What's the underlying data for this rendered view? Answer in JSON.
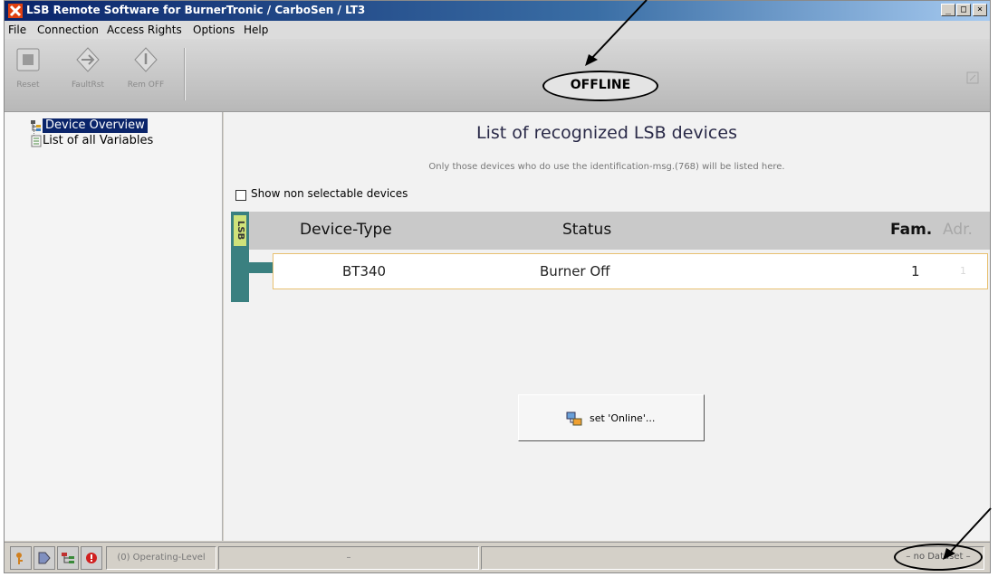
{
  "window": {
    "title": "LSB Remote Software for BurnerTronic / CarboSen / LT3",
    "minimize": "_",
    "maximize": "□",
    "close": "×"
  },
  "menu": [
    "File",
    "Connection",
    "Access Rights",
    "Options",
    "Help"
  ],
  "toolbar": {
    "reset_label": "Reset",
    "faultrst_label": "FaultRst",
    "remoff_label": "Rem OFF",
    "connection_status": "OFFLINE"
  },
  "tree": {
    "items": [
      {
        "label": "Device Overview",
        "selected": true,
        "icon": "device-tree-icon"
      },
      {
        "label": "List of all Variables",
        "selected": false,
        "icon": "variables-list-icon"
      }
    ]
  },
  "main": {
    "title": "List of recognized LSB devices",
    "note": "Only those devices who do use the identification-msg.(768) will be listed here.",
    "show_non_selectable_label": "Show non selectable devices",
    "show_non_selectable_checked": false,
    "bus_label": "LSB",
    "table": {
      "columns": [
        "Device-Type",
        "Status",
        "Fam.",
        "Adr."
      ],
      "rows": [
        {
          "device_type": "BT340",
          "status": "Burner Off",
          "fam": "1",
          "adr": "1"
        }
      ]
    },
    "set_online_label": "set 'Online'..."
  },
  "statusbar": {
    "operating_level": "(0) Operating-Level",
    "middle": "–",
    "dataset": "– no Dataset –"
  },
  "colors": {
    "accent_bus": "#3a8080",
    "bus_label_bg": "#cfe27a",
    "selection": "#0a246a",
    "row_border": "#e8c070"
  }
}
